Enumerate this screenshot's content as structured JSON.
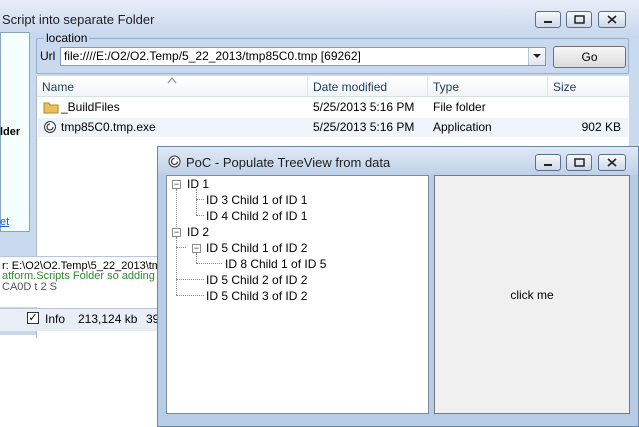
{
  "back_window": {
    "title": "Script into separate Folder",
    "left_panel": {
      "bold_text": "lder",
      "link": "et"
    },
    "location_group": "location",
    "url_label": "Url",
    "url_value": "file:////E:/O2/O2.Temp/5_22_2013/tmp85C0.tmp [69262]",
    "go_label": "Go",
    "columns": [
      "Name",
      "Date modified",
      "Type",
      "Size"
    ],
    "files": [
      {
        "name": "_BuildFiles",
        "date": "5/25/2013 5:16 PM",
        "type": "File folder",
        "size": "",
        "icon": "folder-icon"
      },
      {
        "name": "tmp85C0.tmp.exe",
        "date": "5/25/2013 5:16 PM",
        "type": "Application",
        "size": "902 KB",
        "icon": "application-icon"
      }
    ],
    "console_lines": [
      "r: E:\\O2\\O2.Temp\\5_22_2013\\tm",
      "atform.Scripts Folder so adding it a",
      "CA0D t    2 S   "
    ],
    "status": {
      "info_label": "Info",
      "memory": "213,124 kb",
      "extra": "39"
    }
  },
  "front_window": {
    "title": "PoC - Populate TreeView from data",
    "tree": {
      "id1": "ID 1",
      "id1_c1": "ID 3 Child 1 of ID 1",
      "id1_c2": "ID 4 Child 2 of ID 1",
      "id2": "ID 2",
      "id2_c1": "ID 5 Child 1 of ID 2",
      "id2_c1_c1": "ID 8 Child 1 of ID 5",
      "id2_c2": "ID 5 Child 2 of ID 2",
      "id2_c3": "ID 5 Child 3 of ID 2"
    },
    "button_label": "click me"
  },
  "colors": {
    "accent": "#1a5fd0",
    "console_text": "#2a8a2a",
    "title_bar": "#c6d6ec"
  }
}
